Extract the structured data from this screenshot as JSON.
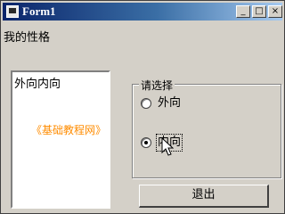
{
  "window": {
    "title": "Form1",
    "controls": {
      "minimize": "_",
      "maximize": "□",
      "close": "×"
    }
  },
  "form": {
    "label": "我的性格",
    "listbox": {
      "items": [
        "外向内向"
      ]
    },
    "group": {
      "legend": "请选择",
      "options": [
        {
          "label": "外向",
          "selected": false
        },
        {
          "label": "内向",
          "selected": true
        }
      ]
    },
    "exit_button": "退出",
    "watermark": "《基础教程网》"
  },
  "icons": {
    "app": "app-icon",
    "cursor": "mouse-pointer-icon"
  }
}
